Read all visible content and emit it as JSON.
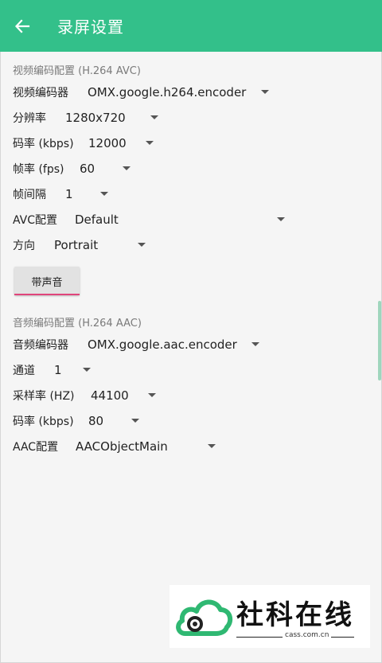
{
  "appbar": {
    "title": "录屏设置",
    "back_icon": "arrow-left-icon",
    "color": "#33c08a"
  },
  "video": {
    "section_title": "视频编码配置 (H.264 AVC)",
    "rows": [
      {
        "label": "视频编码器",
        "value": "OMX.google.h264.encoder"
      },
      {
        "label": "分辨率",
        "value": "1280x720"
      },
      {
        "label": "码率 (kbps)",
        "value": "12000"
      },
      {
        "label": "帧率 (fps)",
        "value": "60"
      },
      {
        "label": "帧间隔",
        "value": "1"
      },
      {
        "label": "AVC配置",
        "value": "Default"
      },
      {
        "label": "方向",
        "value": "Portrait"
      }
    ]
  },
  "audio_toggle": {
    "label": "带声音",
    "underline_color": "#e0457b"
  },
  "audio": {
    "section_title": "音频编码配置 (H.264 AAC)",
    "rows": [
      {
        "label": "音频编码器",
        "value": "OMX.google.aac.encoder"
      },
      {
        "label": "通道",
        "value": "1"
      },
      {
        "label": "采样率 (HZ)",
        "value": "44100"
      },
      {
        "label": "码率 (kbps)",
        "value": "80"
      },
      {
        "label": "AAC配置",
        "value": "AACObjectMain"
      }
    ]
  },
  "watermark": {
    "brand": "社科在线",
    "domain": "cass.com.cn",
    "logo_icon": "cloud-logo-icon"
  }
}
